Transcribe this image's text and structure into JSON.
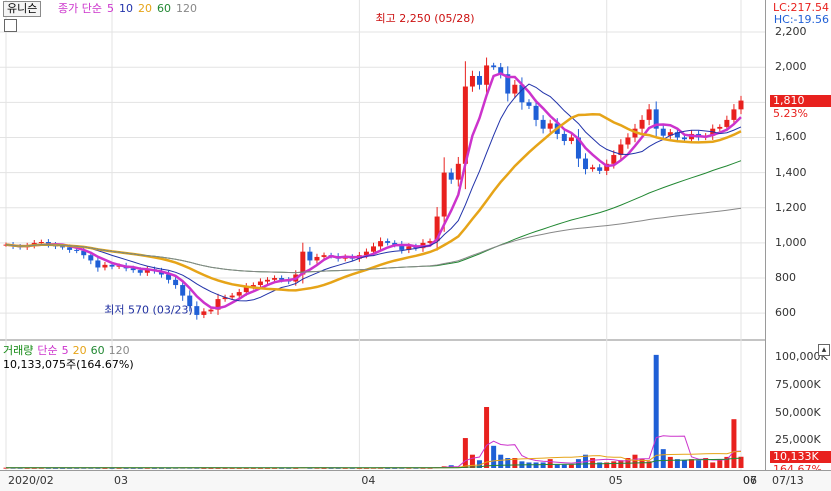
{
  "stock": {
    "name": "유니슨"
  },
  "price_panel": {
    "legend": [
      {
        "label": "종가 단순",
        "color": "#cc33cc"
      },
      {
        "label": "5",
        "color": "#cc33cc"
      },
      {
        "label": "10",
        "color": "#2233aa"
      },
      {
        "label": "20",
        "color": "#e6a418"
      },
      {
        "label": "60",
        "color": "#228833"
      },
      {
        "label": "120",
        "color": "#888888"
      }
    ],
    "lc": "LC:217.54",
    "hc": "HC:-19.56",
    "high_annotation": "최고 2,250 (05/28)",
    "low_annotation": "최저 570 (03/23)",
    "current_price": "1,810",
    "change_pct": "5.23%",
    "y_ticks": [
      "2,200",
      "2,000",
      "1,800",
      "1,600",
      "1,400",
      "1,200",
      "1,000",
      "800",
      "600"
    ],
    "y_tick_values": [
      2200,
      2000,
      1800,
      1600,
      1400,
      1200,
      1000,
      800,
      600
    ],
    "ylim": [
      470,
      2280
    ]
  },
  "volume_panel": {
    "legend": [
      {
        "label": "거래량",
        "color": "#118811"
      },
      {
        "label": "단순",
        "color": "#cc33cc"
      },
      {
        "label": "5",
        "color": "#cc33cc"
      },
      {
        "label": "20",
        "color": "#e6a418"
      },
      {
        "label": "60",
        "color": "#228833"
      },
      {
        "label": "120",
        "color": "#888888"
      }
    ],
    "value_text": "10,133,075주(164.67%)",
    "y_ticks": [
      "100,000K",
      "75,000K",
      "50,000K",
      "25,000K"
    ],
    "y_tick_values": [
      100000,
      75000,
      50000,
      25000
    ],
    "current_volume": "10,133K",
    "current_pct": "164.67%",
    "ylim": [
      0,
      110000
    ]
  },
  "time_axis": {
    "labels": [
      "2020/02",
      "03",
      "04",
      "05",
      "06",
      "07",
      "07/13"
    ]
  },
  "colors": {
    "up": "#e8211e",
    "down": "#1f5fd6",
    "ma5": "#cc33cc",
    "ma10": "#2233aa",
    "ma20": "#e6a418",
    "ma60": "#228833",
    "ma120": "#888888"
  },
  "chart_data": {
    "type": "candlestick",
    "x_labels": [
      "2020/02",
      "03",
      "04",
      "05",
      "06",
      "07",
      "07/13"
    ],
    "label_index": [
      0,
      15,
      50,
      85,
      114,
      146,
      170
    ],
    "close": [
      990,
      980,
      975,
      985,
      1000,
      1005,
      990,
      980,
      975,
      960,
      955,
      930,
      900,
      860,
      875,
      865,
      870,
      855,
      845,
      830,
      850,
      840,
      820,
      790,
      760,
      700,
      640,
      590,
      610,
      620,
      680,
      690,
      700,
      720,
      750,
      760,
      780,
      790,
      800,
      790,
      780,
      820,
      950,
      900,
      920,
      930,
      925,
      910,
      920,
      910,
      930,
      950,
      980,
      1010,
      1000,
      990,
      960,
      980,
      970,
      1000,
      1010,
      1150,
      1400,
      1360,
      1450,
      1890,
      1950,
      1900,
      2010,
      2000,
      1960,
      1850,
      1900,
      1800,
      1780,
      1700,
      1650,
      1680,
      1620,
      1580,
      1600,
      1480,
      1420,
      1430,
      1410,
      1450,
      1500,
      1560,
      1600,
      1650,
      1700,
      1760,
      1650,
      1610,
      1630,
      1600,
      1590,
      1620,
      1600,
      1610,
      1650,
      1660,
      1700,
      1760,
      1810
    ],
    "volume_k": [
      300,
      250,
      200,
      150,
      150,
      200,
      150,
      100,
      100,
      150,
      150,
      200,
      200,
      150,
      100,
      100,
      150,
      100,
      100,
      100,
      150,
      100,
      100,
      100,
      200,
      300,
      250,
      200,
      100,
      100,
      100,
      100,
      100,
      100,
      100,
      100,
      100,
      100,
      100,
      100,
      100,
      100,
      500,
      200,
      200,
      100,
      100,
      100,
      100,
      100,
      100,
      100,
      200,
      200,
      100,
      100,
      200,
      200,
      200,
      200,
      200,
      800,
      1500,
      2500,
      1200,
      27000,
      12000,
      7000,
      55000,
      20000,
      12000,
      9000,
      9000,
      6000,
      5000,
      5000,
      5000,
      8000,
      3000,
      3000,
      3000,
      8000,
      12000,
      9000,
      5000,
      5000,
      6000,
      7000,
      9000,
      12000,
      8000,
      6000,
      102000,
      17000,
      10000,
      8000,
      7000,
      8000,
      7000,
      9000,
      5000,
      7000,
      10000,
      44000,
      10133
    ]
  }
}
